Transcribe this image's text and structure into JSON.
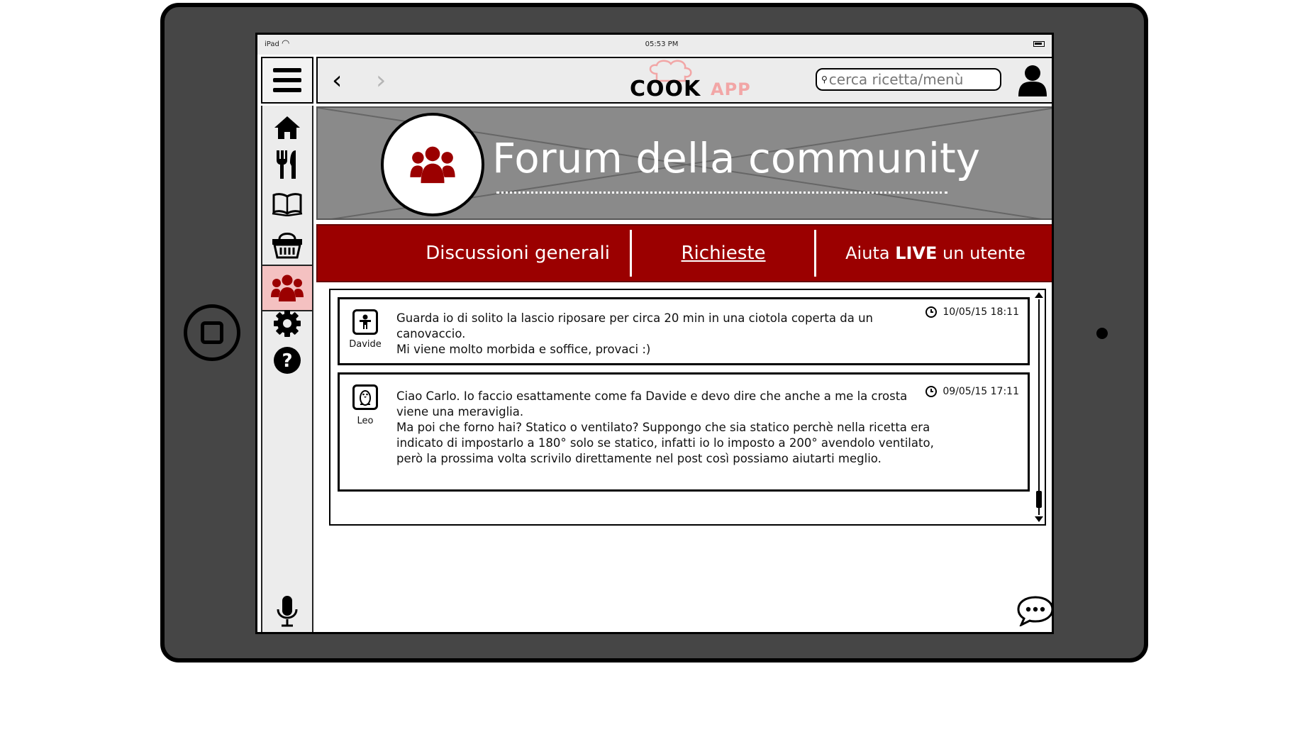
{
  "status_bar": {
    "device": "iPad",
    "time": "05:53 PM"
  },
  "top_bar": {
    "back_icon": "chevron-left",
    "forward_icon": "chevron-right",
    "logo": {
      "part1": "COOK",
      "part2": "APP"
    },
    "search_placeholder": "cerca ricetta/menù",
    "profile_icon": "user-icon"
  },
  "sidebar": {
    "items": [
      {
        "icon": "home-icon"
      },
      {
        "icon": "cutlery-icon"
      },
      {
        "icon": "book-icon"
      },
      {
        "icon": "basket-icon"
      },
      {
        "icon": "community-icon",
        "active": true
      },
      {
        "icon": "gear-icon"
      },
      {
        "icon": "help-icon"
      },
      {
        "icon": "microphone-icon"
      }
    ]
  },
  "banner": {
    "title": "Forum della community"
  },
  "tabs": [
    {
      "label": "Discussioni generali"
    },
    {
      "label": "Richieste",
      "active": true
    },
    {
      "label_before": "Aiuta ",
      "label_bold": "LIVE",
      "label_after": " un utente"
    }
  ],
  "posts": [
    {
      "user": "Davide",
      "date": "10/05/15 18:11",
      "lines": [
        "Guarda io di solito la lascio riposare per circa 20 min in una ciotola coperta da un canovaccio.",
        "Mi viene molto morbida e soffice, provaci :)"
      ]
    },
    {
      "user": "Leo",
      "date": "09/05/15 17:11",
      "lines": [
        "Ciao Carlo. Io faccio esattamente come fa Davide e devo dire che anche a me la crosta viene una meraviglia.",
        "Ma poi che forno hai? Statico o ventilato? Suppongo che sia statico perchè nella ricetta era indicato di impostarlo a 180° solo se statico, infatti io lo imposto a 200° avendolo ventilato, però la prossima volta scrivilo direttamente nel post così possiamo aiutarti meglio."
      ]
    }
  ],
  "colors": {
    "accent": "#9b0000",
    "active_side": "#f4c1c1",
    "logo_app": "#f2a6a6",
    "banner": "#8a8a8a"
  }
}
